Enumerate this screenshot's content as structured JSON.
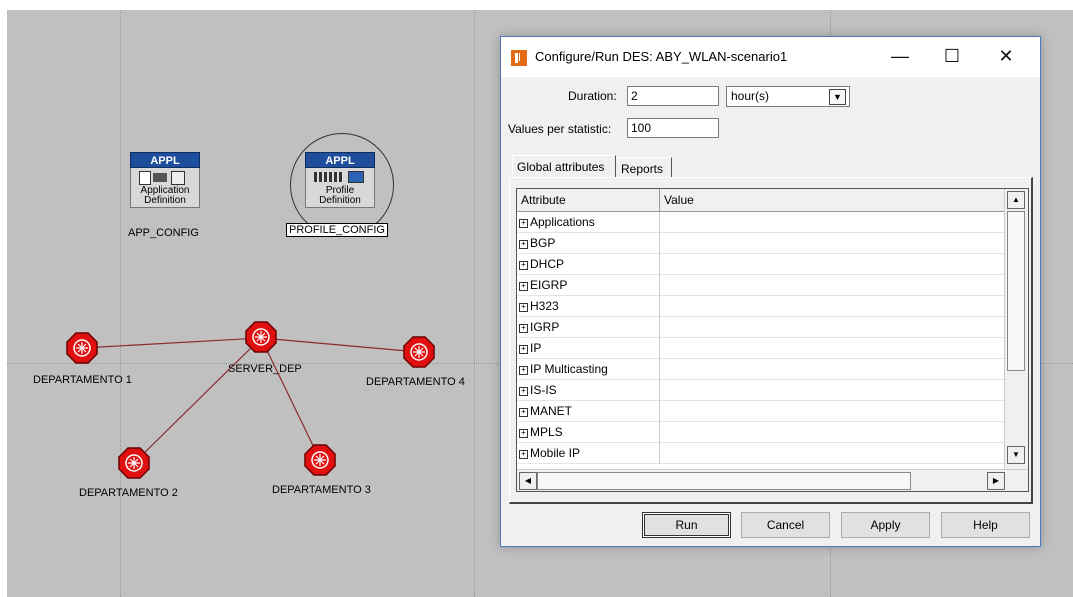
{
  "canvas": {
    "nodes": {
      "app_config": {
        "badge": "APPL",
        "line1": "Application",
        "line2": "Definition",
        "label": "APP_CONFIG"
      },
      "profile_config": {
        "badge": "APPL",
        "line1": "Profile",
        "line2": "Definition",
        "label": "PROFILE_CONFIG"
      },
      "server": "SERVER_DEP",
      "dep1": "DEPARTAMENTO 1",
      "dep2": "DEPARTAMENTO 2",
      "dep3": "DEPARTAMENTO 3",
      "dep4": "DEPARTAMENTO 4"
    }
  },
  "dialog": {
    "title": "Configure/Run DES: ABY_WLAN-scenario1",
    "window_buttons": {
      "minimize": "—",
      "maximize": "☐",
      "close": "✕"
    },
    "duration_label": "Duration:",
    "duration_value": "2",
    "duration_unit": "hour(s)",
    "values_label": "Values per statistic:",
    "values_value": "100",
    "tabs": [
      "Global attributes",
      "Reports"
    ],
    "grid": {
      "headers": [
        "Attribute",
        "Value"
      ],
      "rows": [
        "Applications",
        "BGP",
        "DHCP",
        "EIGRP",
        "H323",
        "IGRP",
        "IP",
        "IP Multicasting",
        "IS-IS",
        "MANET",
        "MPLS",
        "Mobile IP"
      ]
    },
    "buttons": {
      "run": "Run",
      "cancel": "Cancel",
      "apply": "Apply",
      "help": "Help"
    }
  }
}
